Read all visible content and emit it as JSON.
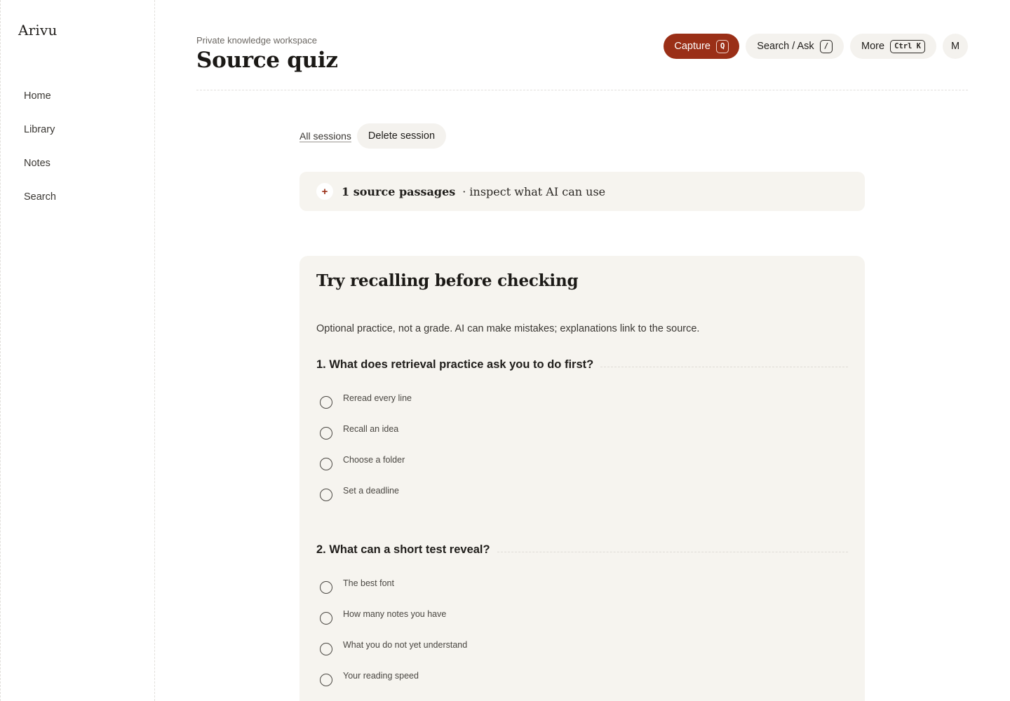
{
  "app": {
    "brand": "Arivu"
  },
  "sidebar": {
    "items": [
      {
        "label": "Home"
      },
      {
        "label": "Library"
      },
      {
        "label": "Notes"
      },
      {
        "label": "Search"
      }
    ]
  },
  "header": {
    "eyebrow": "Private knowledge workspace",
    "title": "Source quiz",
    "capture": {
      "label": "Capture",
      "shortcut": "Q"
    },
    "search": {
      "label": "Search / Ask",
      "shortcut": "/"
    },
    "more": {
      "label": "More",
      "shortcut": "Ctrl K"
    },
    "avatar": "M"
  },
  "toolbar": {
    "all_sessions": "All sessions",
    "delete_session": "Delete session"
  },
  "sources": {
    "icon": "plus-icon",
    "count_label": "1 source passages",
    "hint": "· inspect what AI can use"
  },
  "quiz": {
    "title": "Try recalling before checking",
    "description": "Optional practice, not a grade. AI can make mistakes; explanations link to the source.",
    "questions": [
      {
        "text": "1. What does retrieval practice ask you to do first?",
        "options": [
          "Reread every line",
          "Recall an idea",
          "Choose a folder",
          "Set a deadline"
        ]
      },
      {
        "text": "2. What can a short test reveal?",
        "options": [
          "The best font",
          "How many notes you have",
          "What you do not yet understand",
          "Your reading speed"
        ]
      }
    ]
  },
  "colors": {
    "accent": "#9a2f17",
    "panel": "#f6f4ef",
    "pill": "#f4f2ee"
  }
}
